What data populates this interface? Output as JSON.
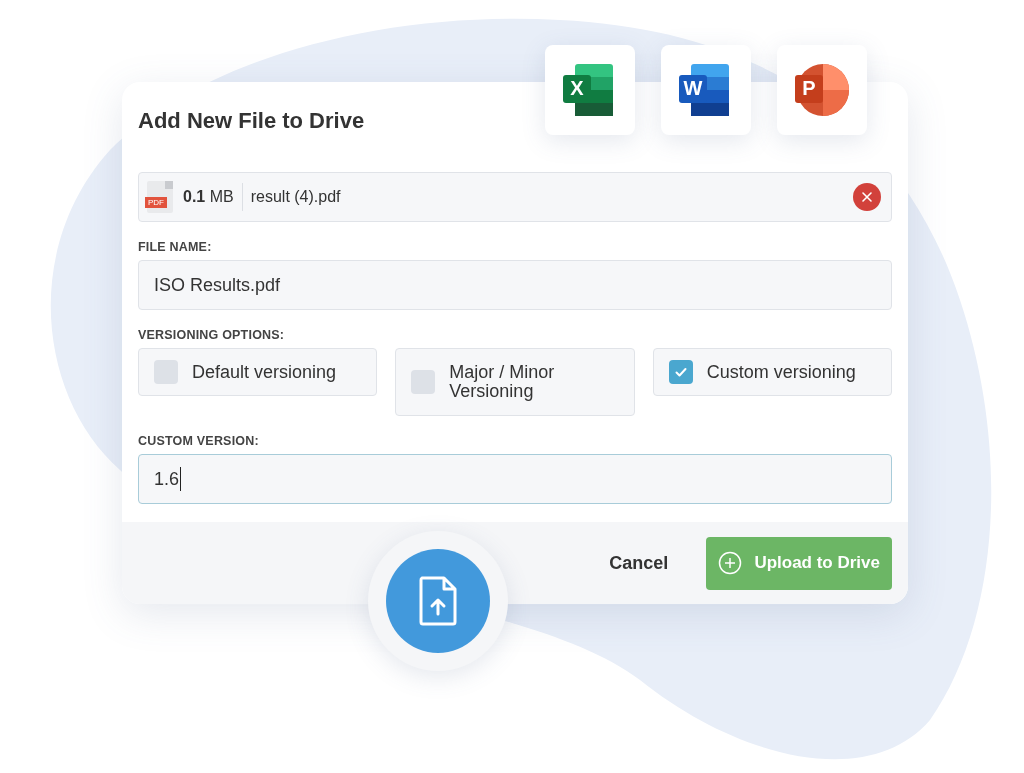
{
  "app_icons": [
    {
      "kind": "excel",
      "letter": "X"
    },
    {
      "kind": "word",
      "letter": "W"
    },
    {
      "kind": "powerpoint",
      "letter": "P"
    }
  ],
  "dialog": {
    "title": "Add New File to Drive"
  },
  "attachment": {
    "file_type": "PDF",
    "size": "**0.1** MB",
    "file_name": "result (4).pdf"
  },
  "file_name": {
    "label": "FILE NAME:",
    "value": "ISO Results.pdf"
  },
  "versioning": {
    "label": "VERSIONING OPTIONS:",
    "options": [
      {
        "label": "Default versioning",
        "checked": false
      },
      {
        "label": "Major / Minor Versioning",
        "checked": false
      },
      {
        "label": "Custom versioning",
        "checked": true
      }
    ]
  },
  "custom_version": {
    "label": "CUSTOM VERSION:",
    "value": "1.6",
    "focused": true
  },
  "buttons": {
    "cancel": "Cancel",
    "upload": "Upload to Drive"
  }
}
